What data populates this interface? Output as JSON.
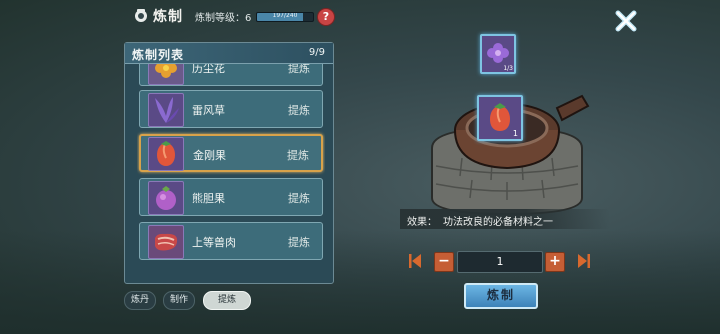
{
  "header": {
    "title": "炼制",
    "level_label": "炼制等级：6",
    "level_progress_text": "197/240",
    "level_progress": 0.82,
    "help_label": "?"
  },
  "list_panel": {
    "title": "炼制列表",
    "count": "9/9",
    "items": [
      {
        "name": "历尘花",
        "action": "提炼",
        "icon": "orange-flower-icon",
        "color": "#d9902a"
      },
      {
        "name": "雷风草",
        "action": "提炼",
        "icon": "purple-grass-icon",
        "color": "#7a5cc0"
      },
      {
        "name": "金刚果",
        "action": "提炼",
        "icon": "red-fruit-icon",
        "color": "#e0563a",
        "selected": true
      },
      {
        "name": "熊胆果",
        "action": "提炼",
        "icon": "purple-berry-icon",
        "color": "#b060c8"
      },
      {
        "name": "上等兽肉",
        "action": "提炼",
        "icon": "meat-icon",
        "color": "#d05a5a"
      }
    ]
  },
  "tabs": [
    {
      "label": "炼丹",
      "active": false
    },
    {
      "label": "制作",
      "active": false
    },
    {
      "label": "提炼",
      "active": true
    }
  ],
  "crafting": {
    "ingredient_icon": "purple-flower-icon",
    "ingredient_count": "1/3",
    "result_icon": "red-fruit-icon",
    "result_count": "1",
    "effect_label": "效果：",
    "effect_text": "功法改良的必备材料之一",
    "quantity": "1",
    "minus_label": "−",
    "plus_label": "+",
    "craft_button": "炼制"
  },
  "colors": {
    "accent_selected": "#d8a24a",
    "button_blue": "#4a90c4",
    "button_orange": "#c55e35"
  }
}
